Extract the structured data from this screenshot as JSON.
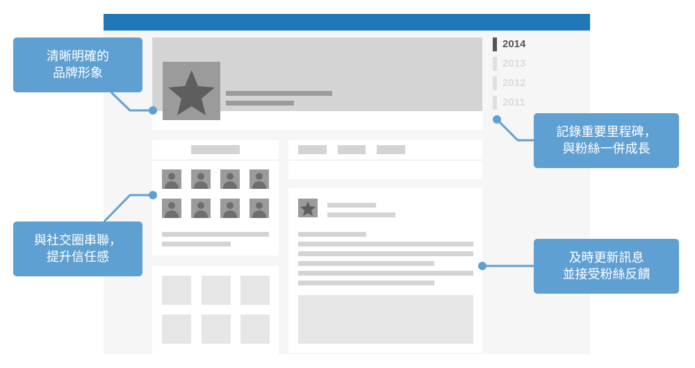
{
  "timeline": {
    "years": [
      "2014",
      "2013",
      "2012",
      "2011"
    ],
    "active": "2014"
  },
  "callouts": {
    "brand": "清晰明確的\n品牌形象",
    "social": "與社交圈串聯，\n提升信任感",
    "milestone": "記錄重要里程碑，\n與粉絲一併成長",
    "update": "及時更新訊息\n並接受粉絲反饋"
  },
  "colors": {
    "accent": "#2077b8",
    "callout": "#5fa0d3"
  }
}
